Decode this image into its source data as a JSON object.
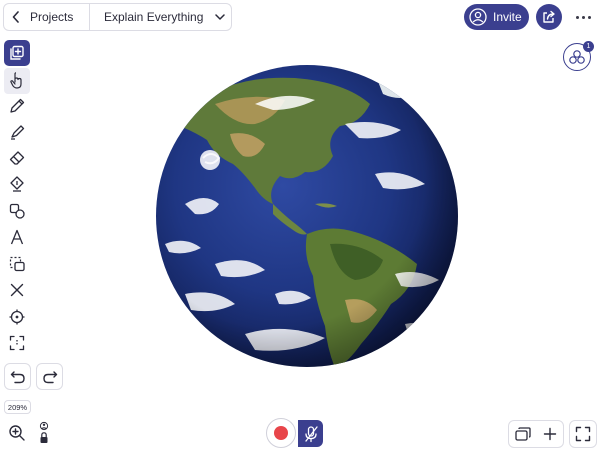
{
  "header": {
    "back_label": "Projects",
    "document_title": "Explain Everything",
    "invite_label": "Invite"
  },
  "collaborators": {
    "count": "1"
  },
  "toolbar": {
    "tools": [
      "add-slide",
      "hand",
      "pen",
      "highlighter",
      "eraser",
      "fill",
      "shapes",
      "text",
      "select",
      "laser",
      "pointer",
      "crop"
    ],
    "active_tool": "add-slide",
    "selected_tool": "hand"
  },
  "zoom": {
    "level": "209%"
  },
  "colors": {
    "accent": "#3b3f8f",
    "record": "#e8454a"
  },
  "canvas": {
    "image": "earth-globe-americas"
  }
}
